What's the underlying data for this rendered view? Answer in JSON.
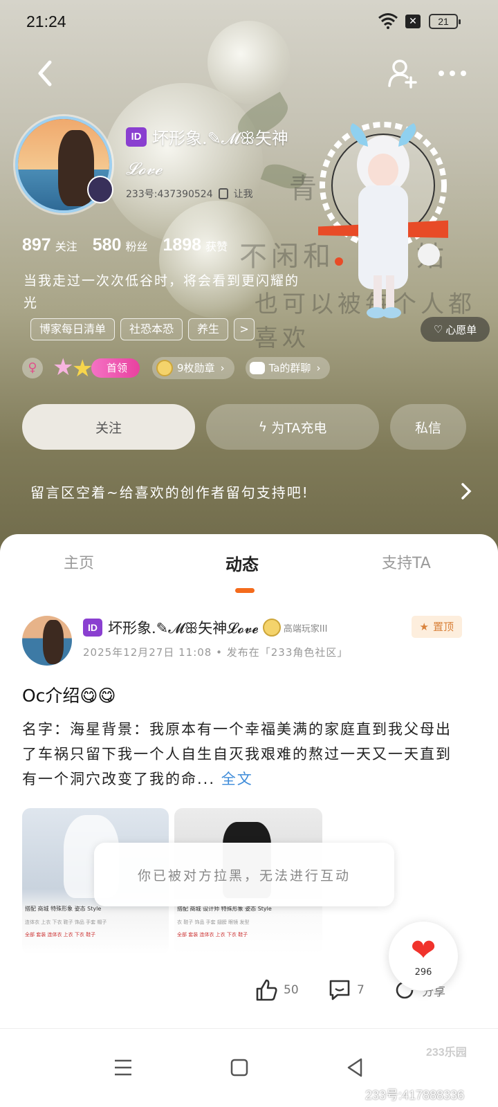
{
  "status_bar": {
    "time": "21:24",
    "battery": "21"
  },
  "profile": {
    "id_badge": "ID",
    "name_line1": "坏形象.✎𝓜ꕥ矢神",
    "name_line2": "𝓛𝓸𝓿𝓮",
    "uid": "233号:437390524",
    "copy_label": "让我",
    "stats": [
      {
        "num": "897",
        "label": "关注"
      },
      {
        "num": "580",
        "label": "粉丝"
      },
      {
        "num": "1898",
        "label": "获赞"
      }
    ],
    "bio": "当我走过一次次低谷时，将会看到更闪耀的光",
    "tags": [
      "博家每日清单",
      "社恐本恐",
      "养生",
      ">"
    ],
    "gender_icon": "female-symbol",
    "badge_pill": "首领",
    "medal_pill": "9枚勋章",
    "group_pill": "Ta的群聊",
    "wish_label": "心愿单"
  },
  "background_text": [
    "青",
    "不闲和",
    "也",
    "也可以被每个人都喜欢",
    "姑"
  ],
  "actions": {
    "follow": "关注",
    "charge": "为TA充电",
    "message": "私信"
  },
  "message_board": "留言区空着~给喜欢的创作者留句支持吧!",
  "tabs": [
    {
      "label": "主页",
      "active": false
    },
    {
      "label": "动态",
      "active": true
    },
    {
      "label": "支持TA",
      "active": false
    }
  ],
  "post": {
    "author_id_badge": "ID",
    "author_name": "坏形象.✎𝓜ꕥ矢神𝓛𝓸𝓿𝓮",
    "level_text": "高端玩家III",
    "pin_label": "置顶",
    "meta": "2025年12月27日 11:08 • 发布在「233角色社区」",
    "title": "Oc介绍😋😋",
    "body": "名字：海星背景：我原本有一个幸福美满的家庭直到我父母出了车祸只留下我一个人自生自灭我艰难的熬过一天又一天直到有一个洞穴改变了我的命...",
    "fulltext_label": "全文",
    "img1_tabs": "搭配  商城  特殊形象  姿态  Style",
    "img1_row2": "连体衣  上衣  下衣  鞋子  饰品  手套  帽子",
    "img1_row3": "全部  套装  连体衣  上衣  下衣  鞋子",
    "img2_tabs": "搭配  商城  设计师  特殊形象  姿态  Style",
    "img2_row2": "衣  鞋子  饰品  手套  翅膀  眼镜  发型",
    "img2_row3": "全部  套装  连体衣  上衣  下衣  鞋子",
    "toast": "你已被对方拉黑，无法进行互动",
    "likes": "50",
    "comments": "7",
    "share": "分享"
  },
  "float_like_count": "296",
  "watermark_logo": "233乐园",
  "watermark": "233号:417888336",
  "colors": {
    "accent": "#f46b1c",
    "id_badge": "#8a3fd0",
    "pink": "#e9419f",
    "link": "#3d8bd9"
  }
}
